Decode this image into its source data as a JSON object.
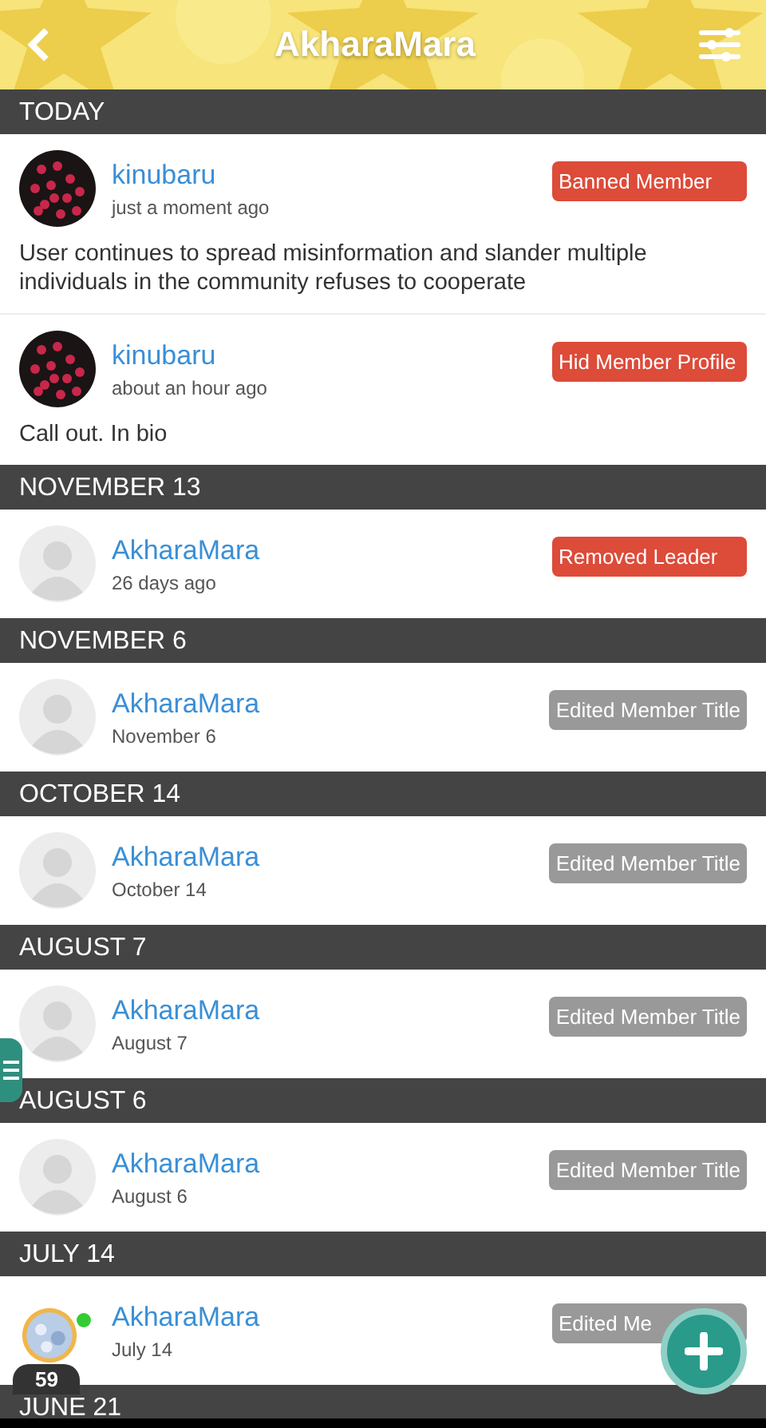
{
  "header": {
    "title": "AkharaMara"
  },
  "sections": [
    {
      "date": "TODAY",
      "entries": [
        {
          "user": "kinubaru",
          "time": "just a moment ago",
          "action": "Banned Member",
          "color": "#dd4b39",
          "note": "User continues to spread misinformation and slander multiple individuals in the community refuses to cooperate"
        },
        {
          "user": "kinubaru",
          "time": "about an hour ago",
          "action": "Hid Member Profile",
          "color": "#dd4b39",
          "note": "Call out. In bio"
        }
      ]
    },
    {
      "date": "NOVEMBER 13",
      "entries": [
        {
          "user": "AkharaMara",
          "kind": "default",
          "time": "26 days ago",
          "action": "Removed Leader",
          "color": "#dd4b39"
        }
      ]
    },
    {
      "date": "NOVEMBER 6",
      "entries": [
        {
          "user": "AkharaMara",
          "kind": "default",
          "time": "November 6",
          "action": "Edited Member Title",
          "color": "#999999"
        }
      ]
    },
    {
      "date": "OCTOBER 14",
      "entries": [
        {
          "user": "AkharaMara",
          "kind": "default",
          "time": "October 14",
          "action": "Edited Member Title",
          "color": "#999999"
        }
      ]
    },
    {
      "date": "AUGUST 7",
      "entries": [
        {
          "user": "AkharaMara",
          "kind": "default",
          "time": "August 7",
          "action": "Edited Member Title",
          "color": "#999999"
        }
      ]
    },
    {
      "date": "AUGUST 6",
      "entries": [
        {
          "user": "AkharaMara",
          "kind": "default",
          "time": "August 6",
          "action": "Edited Member Title",
          "color": "#999999"
        }
      ]
    },
    {
      "date": "JULY 14",
      "entries": [
        {
          "user": "AkharaMara",
          "time": "July 14",
          "action": "Edited Me",
          "color": "#999999"
        }
      ]
    },
    {
      "date": "JUNE 21"
    }
  ],
  "floating_avatar": {
    "count": "59",
    "online": true
  }
}
